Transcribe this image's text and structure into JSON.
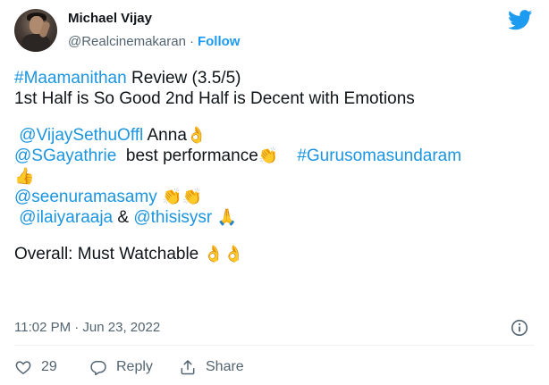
{
  "author": {
    "name": "Michael Vijay",
    "handle": "@Realcinemakaran",
    "separator": "·",
    "follow_label": "Follow"
  },
  "tweet": {
    "l1_hashtag": "#Maamanithan",
    "l1_text": " Review (3.5/5)",
    "l2_text": "1st Half is So Good 2nd Half is Decent with Emotions",
    "l3_mention": "@VijaySethuOffl",
    "l3_text": " Anna",
    "l4_mention": "@SGayathrie",
    "l4_text": "  best performance",
    "l4_hashtag": "#Gurusomasundaram",
    "l6_mention": "@seenuramasamy",
    "l7_mention1": "@ilaiyaraaja",
    "l7_amp": " & ",
    "l7_mention2": "@thisisysr",
    "l9_text": "Overall: Must Watchable "
  },
  "timestamp": "11:02 PM · Jun 23, 2022",
  "actions": {
    "like_count": "29",
    "reply_label": "Reply",
    "share_label": "Share"
  },
  "icons": {
    "brand": "twitter-bird-icon",
    "info": "info-icon",
    "like": "heart-icon",
    "reply": "reply-icon",
    "share": "share-icon"
  },
  "colors": {
    "link": "#1b95e0",
    "follow": "#1d9bf0",
    "muted": "#536471",
    "text": "#0f1419"
  }
}
